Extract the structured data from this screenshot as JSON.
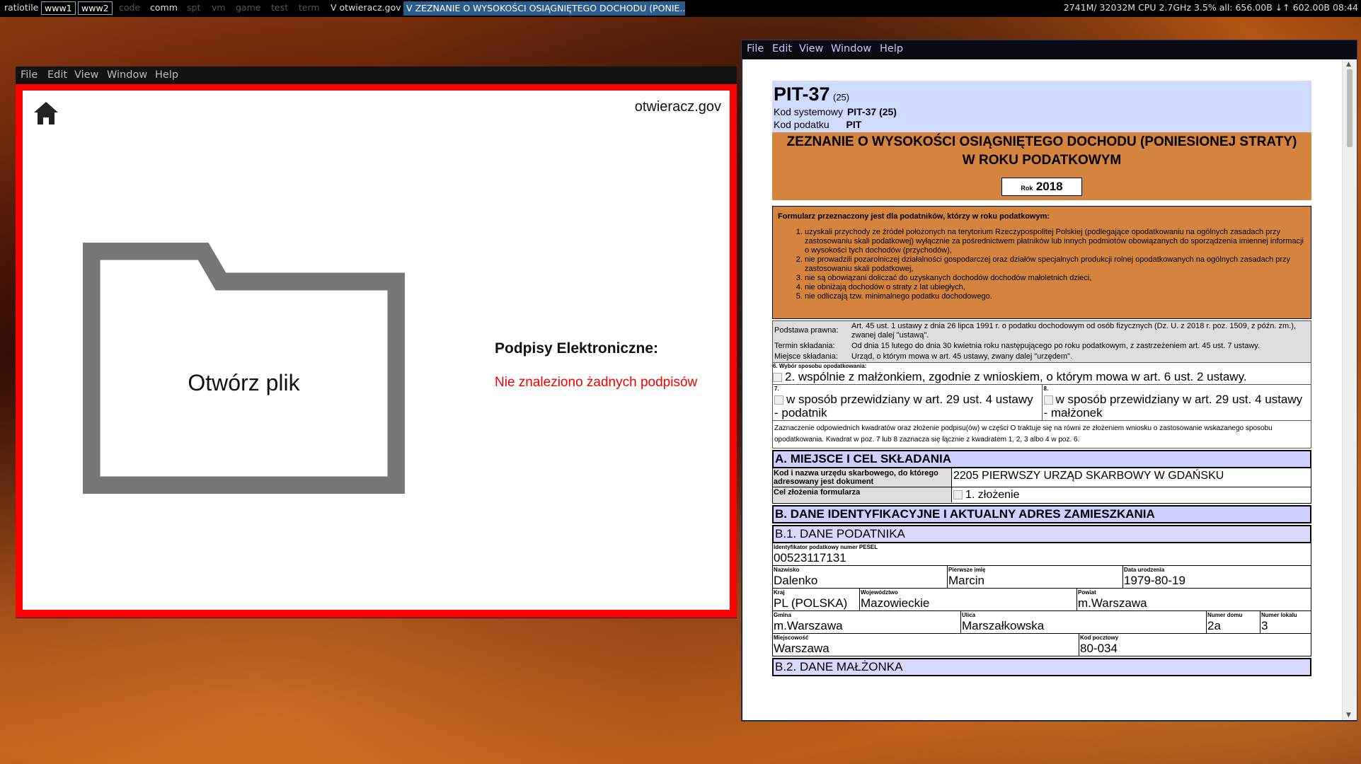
{
  "topbar": {
    "wm_name": "ratiotile",
    "workspaces": [
      {
        "label": "www1",
        "state": "active"
      },
      {
        "label": "www2",
        "state": "active"
      },
      {
        "label": "code",
        "state": "dim"
      },
      {
        "label": "comm",
        "state": "normal"
      },
      {
        "label": "spt",
        "state": "dim"
      },
      {
        "label": "vm",
        "state": "dim"
      },
      {
        "label": "game",
        "state": "dim"
      },
      {
        "label": "test",
        "state": "dim"
      },
      {
        "label": "term",
        "state": "dim"
      }
    ],
    "window1_title": "V otwieracz.gov",
    "window2_title": "V ZEZNANIE O WYSOKOŚCI OSIĄGNIĘTEGO DOCHODU (PONIE...",
    "status": "2741M/ 32032M CPU 2.7GHz 3.5% all: 656.00B ↓↑ 602.00B 08:44"
  },
  "left_window": {
    "menu": [
      "File",
      "Edit",
      "View",
      "Window",
      "Help"
    ],
    "site": "otwieracz.gov",
    "open_file_label": "Otwórz plik",
    "signatures_title": "Podpisy Elektroniczne:",
    "signatures_status": "Nie znaleziono żadnych podpisów",
    "frame_color": "#ff0000"
  },
  "right_window": {
    "menu": [
      "File",
      "Edit",
      "View",
      "Window",
      "Help"
    ],
    "form": {
      "code": "PIT-37",
      "version": "(25)",
      "system_code_label": "Kod systemowy",
      "system_code": "PIT-37 (25)",
      "tax_code_label": "Kod podatku",
      "tax_code": "PIT",
      "title_line1": "ZEZNANIE O WYSOKOŚCI OSIĄGNIĘTEGO DOCHODU (PONIESIONEJ STRATY)",
      "title_line2": "W ROKU PODATKOWYM",
      "year_label": "Rok",
      "year": "2018",
      "intro": "Formularz przeznaczony jest dla podatników, którzy w roku podatkowym:",
      "conditions": [
        "uzyskali przychody ze źródeł położonych na terytorium Rzeczypospolitej Polskiej (podlegające opodatkowaniu na ogólnych zasadach przy zastosowaniu skali podatkowej) wyłącznie za pośrednictwem płatników lub innych podmiotów obowiązanych do sporządzenia imiennej informacji o wysokości tych dochodów (przychodów),",
        "nie prowadzili pozarolniczej działalności gospodarczej oraz działów specjalnych produkcji rolnej opodatkowanych na ogólnych zasadach przy zastosowaniu skali podatkowej,",
        "nie są obowiązani doliczać do uzyskanych dochodów dochodów małoletnich dzieci,",
        "nie obniżają dochodów o straty z lat ubiegłych,",
        "nie odliczają tzw. minimalnego podatku dochodowego."
      ],
      "legal": [
        {
          "label": "Podstawa prawna:",
          "text": "Art. 45 ust. 1 ustawy z dnia 26 lipca 1991 r. o podatku dochodowym od osób fizycznych (Dz. U. z 2018 r. poz. 1509, z późn. zm.), zwanej dalej \"ustawą\"."
        },
        {
          "label": "Termin składania:",
          "text": "Od dnia 15 lutego do dnia 30 kwietnia roku następującego po roku podatkowym, z zastrzeżeniem art. 45 ust. 7 ustawy."
        },
        {
          "label": "Miejsce składania:",
          "text": "Urząd, o którym mowa w art. 45 ustawy, zwany dalej \"urzędem\"."
        }
      ],
      "field6_label": "6. Wybór sposobu opodatkowania:",
      "field6_value": "2. wspólnie z małżonkiem, zgodnie z wnioskiem, o którym mowa w art. 6 ust. 2 ustawy.",
      "field7_num": "7.",
      "field7_text": "w sposób przewidziany w art. 29 ust. 4 ustawy - podatnik",
      "field8_num": "8.",
      "field8_text": "w sposób przewidziany w art. 29 ust. 4 ustawy - małżonek",
      "note": "Zaznaczenie odpowiednich kwadratów oraz złożenie podpisu(ów) w części O traktuje się na równi ze złożeniem wniosku o zastosowanie wskazanego sposobu opodatkowania. Kwadrat w poz. 7 lub 8 zaznacza się łącznie z kwadratem 1, 2, 3 albo 4 w poz. 6.",
      "section_a": "A. MIEJSCE I CEL SKŁADANIA",
      "office_label": "Kod i nazwa urzędu skarbowego, do którego adresowany jest dokument",
      "office_value": "2205  PIERWSZY URZĄD SKARBOWY W GDAŃSKU",
      "purpose_label": "Cel złożenia formularza",
      "purpose_value": "1. złożenie",
      "section_b": "B. DANE IDENTYFIKACYJNE I AKTUALNY ADRES ZAMIESZKANIA",
      "section_b1": "B.1. DANE PODATNIKA",
      "pesel_label": "Identyfikator podatkowy numer PESEL",
      "pesel": "00523117131",
      "surname_label": "Nazwisko",
      "surname": "Dalenko",
      "firstname_label": "Pierwsze imię",
      "firstname": "Marcin",
      "birth_label": "Data urodzenia",
      "birth": "1979-80-19",
      "country_label": "Kraj",
      "country": "PL  (POLSKA)",
      "voiv_label": "Województwo",
      "voiv": "Mazowieckie",
      "county_label": "Powiat",
      "county": "m.Warszawa",
      "gmina_label": "Gmina",
      "gmina": "m.Warszawa",
      "street_label": "Ulica",
      "street": "Marszałkowska",
      "house_label": "Numer domu",
      "house": "2a",
      "flat_label": "Numer lokalu",
      "flat": "3",
      "city_label": "Miejscowość",
      "city": "Warszawa",
      "zip_label": "Kod pocztowy",
      "zip": "80-034",
      "section_b2": "B.2. DANE MAŁŻONKA"
    }
  }
}
